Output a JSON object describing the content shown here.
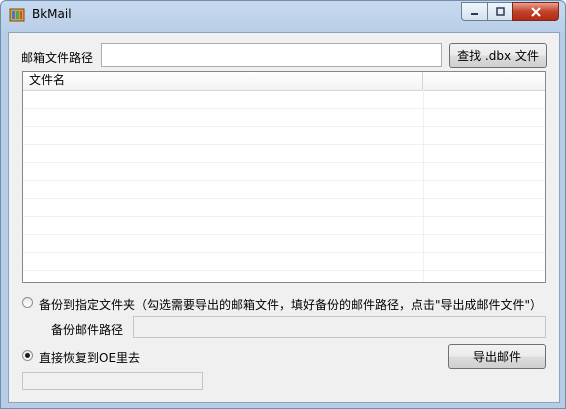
{
  "window": {
    "title": "BkMail"
  },
  "mailbox_path": {
    "label": "邮箱文件路径",
    "value": ""
  },
  "find_button": {
    "label": "查找 .dbx 文件"
  },
  "file_list": {
    "columns": [
      "文件名",
      ""
    ],
    "rows": []
  },
  "option_backup": {
    "label": "备份到指定文件夹（勾选需要导出的邮箱文件，填好备份的邮件路径，点击\"导出成邮件文件\"）",
    "selected": false
  },
  "backup_path": {
    "label": "备份邮件路径",
    "value": ""
  },
  "option_restore": {
    "label": "直接恢复到OE里去",
    "selected": true
  },
  "export_button": {
    "label": "导出邮件"
  },
  "progress": {
    "value": 0
  },
  "icons": [
    "app-icon",
    "minimize-icon",
    "maximize-icon",
    "close-icon"
  ]
}
